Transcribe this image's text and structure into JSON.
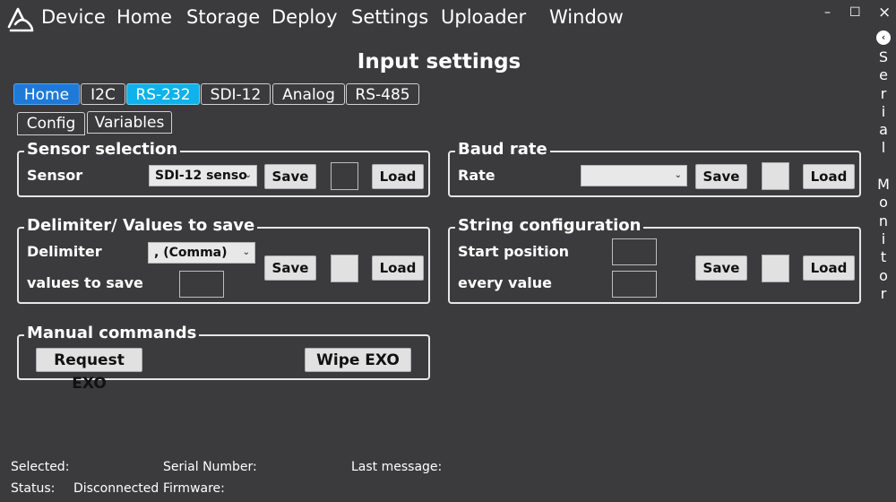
{
  "menu": {
    "items": [
      "Device",
      "Home",
      "Storage",
      "Deploy",
      "Settings",
      "Uploader",
      "Window"
    ]
  },
  "window_controls": {
    "minimize": "–",
    "maximize": "☐",
    "close": "×"
  },
  "page": {
    "title": "Input settings"
  },
  "tabs": [
    "Home",
    "I2C",
    "RS-232",
    "SDI-12",
    "Analog",
    "RS-485"
  ],
  "subtabs": [
    "Config",
    "Variables"
  ],
  "sensor_selection": {
    "title": "Sensor selection",
    "label": "Sensor",
    "select_value": "SDI-12 senso",
    "save": "Save",
    "load": "Load"
  },
  "baud_rate": {
    "title": "Baud rate",
    "label": "Rate",
    "select_value": "",
    "save": "Save",
    "load": "Load"
  },
  "delimiter": {
    "title": "Delimiter/ Values to save",
    "label_delimiter": "Delimiter",
    "select_value": ", (Comma)",
    "label_values": "values to save",
    "save": "Save",
    "load": "Load"
  },
  "string_config": {
    "title": "String configuration",
    "label_start": "Start position",
    "label_every": "every value",
    "save": "Save",
    "load": "Load"
  },
  "manual": {
    "title": "Manual commands",
    "request": "Request EXO",
    "wipe": "Wipe EXO"
  },
  "serial_monitor": {
    "letters": [
      "S",
      "e",
      "r",
      "i",
      "a",
      "l",
      " ",
      "M",
      "o",
      "n",
      "i",
      "t",
      "o",
      "r"
    ]
  },
  "status": {
    "selected": "Selected:",
    "serial_number": "Serial Number:",
    "last_message": "Last message:",
    "status_label": "Status:",
    "status_value": "Disconnected",
    "firmware": "Firmware:"
  }
}
